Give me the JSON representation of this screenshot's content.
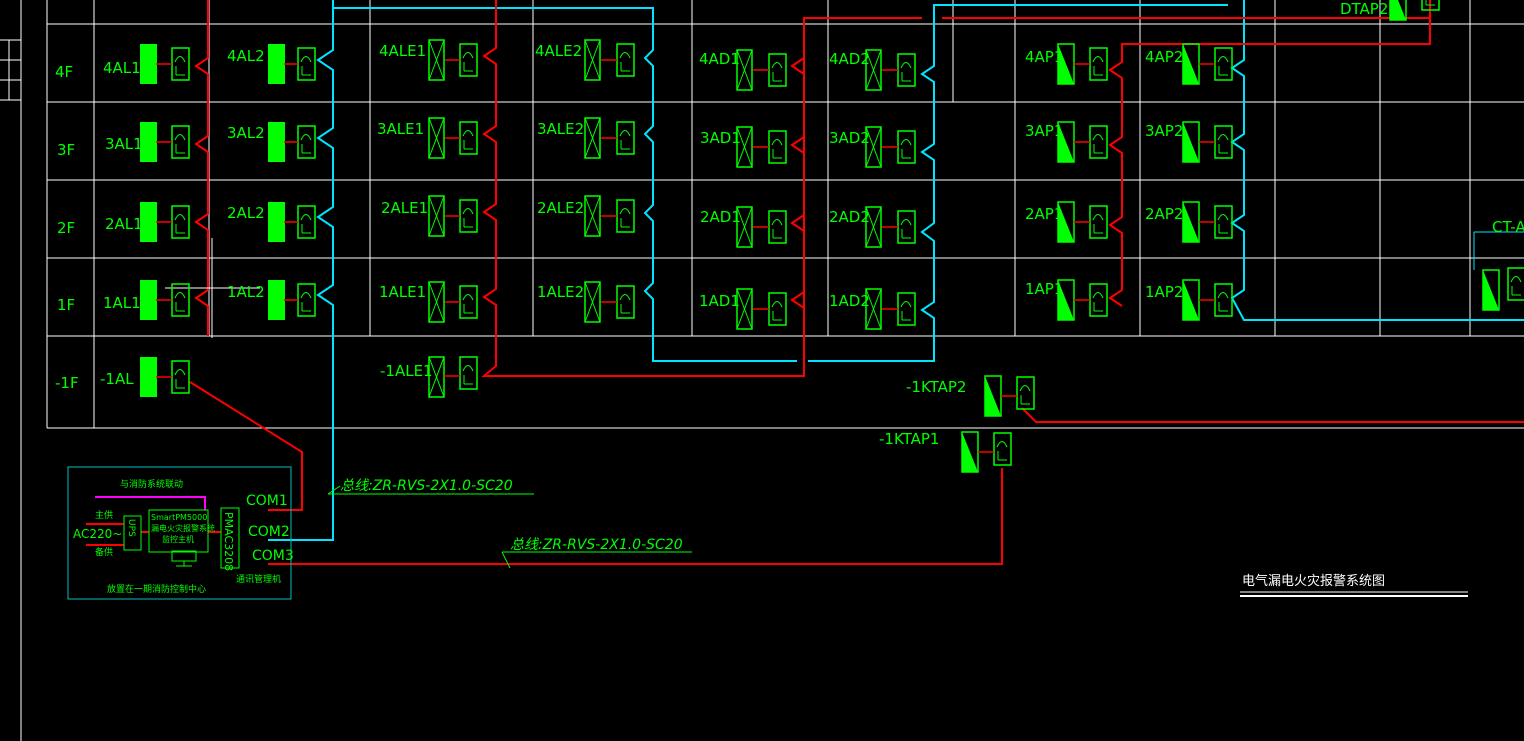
{
  "colors": {
    "background": "#000000",
    "grid": "#ffffff",
    "text": "#00ff00",
    "red_line": "#ff0000",
    "cyan_line": "#00e5ff",
    "magenta_line": "#ff00ff",
    "box_border": "#00bfbf",
    "panel_fill": "#00ff00"
  },
  "floors": [
    "4F",
    "3F",
    "2F",
    "1F",
    "-1F"
  ],
  "panels": {
    "f4": [
      "4AL1",
      "4AL2",
      "4ALE1",
      "4ALE2",
      "4AD1",
      "4AD2",
      "4AP1",
      "4AP2"
    ],
    "f3": [
      "3AL1",
      "3AL2",
      "3ALE1",
      "3ALE2",
      "3AD1",
      "3AD2",
      "3AP1",
      "3AP2"
    ],
    "f2": [
      "2AL1",
      "2AL2",
      "2ALE1",
      "2ALE2",
      "2AD1",
      "2AD2",
      "2AP1",
      "2AP2"
    ],
    "f1": [
      "1AL1",
      "1AL2",
      "1ALE1",
      "1ALE2",
      "1AD1",
      "1AD2",
      "1AP1",
      "1AP2"
    ],
    "b1": [
      "-1AL",
      "-1ALE1"
    ],
    "dtap2": "DTAP2",
    "ct": "CT-A",
    "ktap2": "-1KTAP2",
    "ktap1": "-1KTAP1"
  },
  "control_center": {
    "fire_link": "与消防系统联动",
    "main_power": "主供",
    "ac": "AC220~",
    "backup_power": "备供",
    "ups": "UPS",
    "host_line1": "SmartPM5000",
    "host_line2": "漏电火灾报警系统",
    "host_line3": "监控主机",
    "comm_unit": "PMAC3208",
    "comm_label": "通讯管理机",
    "com1": "COM1",
    "com2": "COM2",
    "com3": "COM3",
    "location": "放置在一期消防控制中心"
  },
  "bus_label_1": "总线:ZR-RVS-2X1.0-SC20",
  "bus_label_2": "总线:ZR-RVS-2X1.0-SC20",
  "drawing_title": "电气漏电火灾报警系统图"
}
